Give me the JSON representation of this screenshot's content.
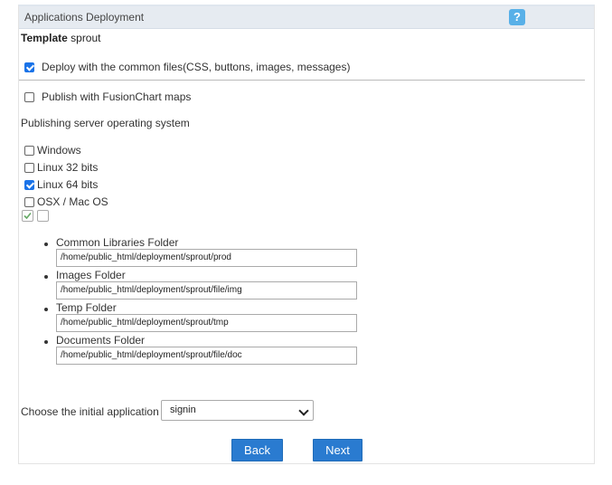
{
  "header": {
    "title": "Applications Deployment",
    "help_label": "?"
  },
  "template": {
    "label": "Template",
    "value": "sprout"
  },
  "options": {
    "deploy_common": {
      "label": "Deploy with the common files(CSS, buttons, images, messages)",
      "checked": true
    },
    "fusionchart": {
      "label": "Publish with FusionChart maps",
      "checked": false
    }
  },
  "os": {
    "title": "Publishing server operating system",
    "items": [
      {
        "label": "Windows",
        "checked": false
      },
      {
        "label": "Linux 32 bits",
        "checked": false
      },
      {
        "label": "Linux 64 bits",
        "checked": true
      },
      {
        "label": "OSX / Mac OS",
        "checked": false
      }
    ]
  },
  "folders": [
    {
      "label": "Common Libraries Folder",
      "value": "/home/public_html/deployment/sprout/prod"
    },
    {
      "label": "Images Folder",
      "value": "/home/public_html/deployment/sprout/file/img"
    },
    {
      "label": "Temp Folder",
      "value": "/home/public_html/deployment/sprout/tmp"
    },
    {
      "label": "Documents Folder",
      "value": "/home/public_html/deployment/sprout/file/doc"
    }
  ],
  "initial_app": {
    "label": "Choose the initial application",
    "selected": "signin"
  },
  "buttons": {
    "back": "Back",
    "next": "Next"
  },
  "colors": {
    "accent": "#2a7bd0",
    "header_bg": "#e6ebf1",
    "help_bg": "#58b0e8"
  }
}
